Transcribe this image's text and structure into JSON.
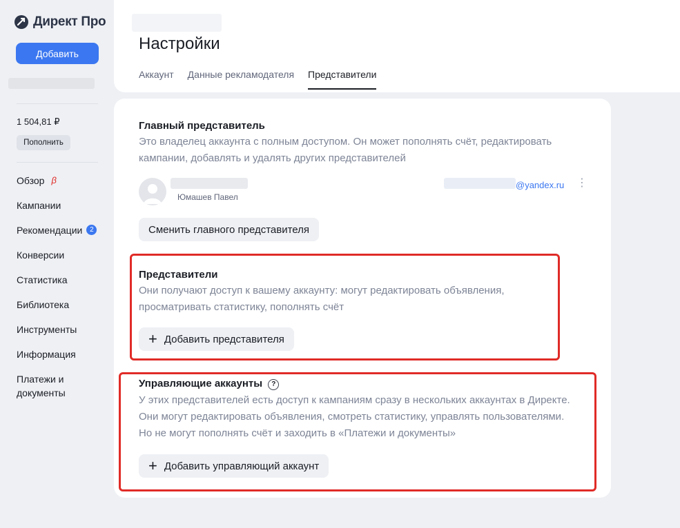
{
  "app": {
    "logo_text": "Директ Про",
    "add_label": "Добавить"
  },
  "sidebar": {
    "balance": "1 504,81 ₽",
    "topup_label": "Пополнить",
    "items": [
      {
        "label": "Обзор",
        "beta": "β"
      },
      {
        "label": "Кампании"
      },
      {
        "label": "Рекомендации",
        "badge": "2"
      },
      {
        "label": "Конверсии"
      },
      {
        "label": "Статистика"
      },
      {
        "label": "Библиотека"
      },
      {
        "label": "Инструменты"
      },
      {
        "label": "Информация"
      },
      {
        "label": "Платежи и документы"
      }
    ]
  },
  "header": {
    "title": "Настройки",
    "tabs": [
      {
        "label": "Аккаунт",
        "active": false
      },
      {
        "label": "Данные рекламодателя",
        "active": false
      },
      {
        "label": "Представители",
        "active": true
      }
    ]
  },
  "main_rep": {
    "title": "Главный представитель",
    "desc": "Это владелец аккаунта с полным доступом. Он может пополнять счёт, редактировать кампании, добавлять и удалять других представителей",
    "person_name": "Юмашев Павел",
    "email_suffix": "@yandex.ru",
    "change_label": "Сменить главного представителя"
  },
  "reps": {
    "title": "Представители",
    "desc": "Они получают доступ к вашему аккаунту: могут редактировать объявления, просматривать статистику, пополнять счёт",
    "add_label": "Добавить представителя"
  },
  "managing": {
    "title": "Управляющие аккаунты",
    "desc": "У этих представителей есть доступ к кампаниям сразу в нескольких аккаунтах в Директе. Они могут редактировать объявления, смотреть статистику, управлять пользователями. Но не могут пополнять счёт и заходить в «Платежи и документы»",
    "add_label": "Добавить управляющий аккаунт"
  },
  "colors": {
    "accent": "#3b77f0",
    "highlight": "#e02b27",
    "beta": "#e02b27"
  }
}
